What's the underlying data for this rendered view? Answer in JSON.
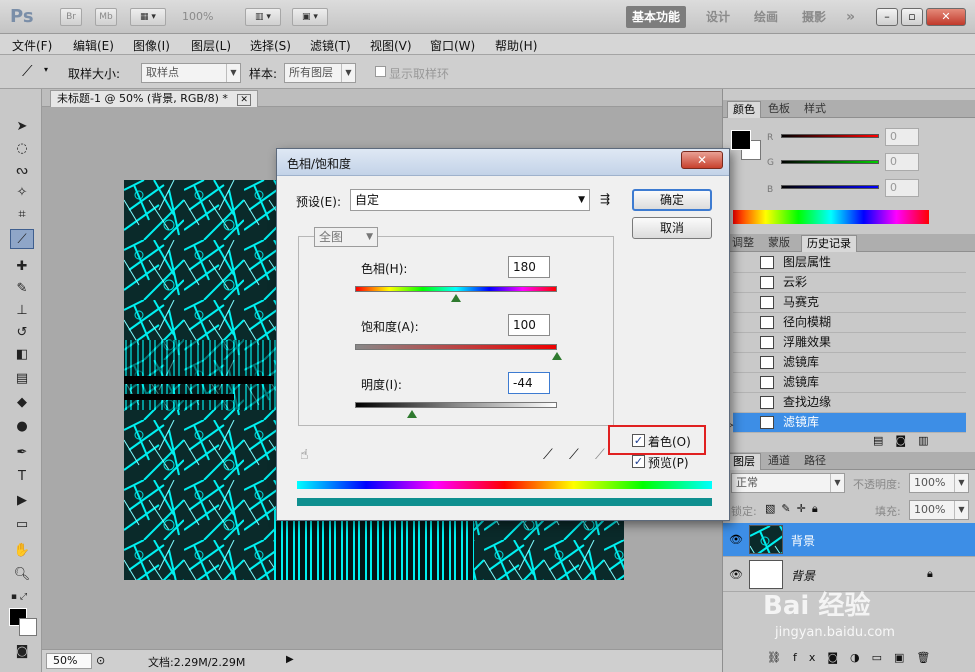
{
  "app": {
    "logo": "Ps",
    "zoom_readout": "100%"
  },
  "appbar": {
    "bridge": "Br",
    "minibridge": "Mb",
    "workspaces": [
      "基本功能",
      "设计",
      "绘画",
      "摄影"
    ],
    "more": "»",
    "window_buttons": [
      "–",
      "▫",
      "✕"
    ]
  },
  "menu": [
    "文件(F)",
    "编辑(E)",
    "图像(I)",
    "图层(L)",
    "选择(S)",
    "滤镜(T)",
    "视图(V)",
    "窗口(W)",
    "帮助(H)"
  ],
  "options": {
    "sample_size_label": "取样大小:",
    "sample_size_value": "取样点",
    "sample_label": "样本:",
    "sample_value": "所有图层",
    "show_ring_label": "显示取样环"
  },
  "document": {
    "tab_title": "未标题-1 @ 50% (背景, RGB/8) *",
    "status_zoom": "50%",
    "status_doc": "文档:2.29M/2.29M"
  },
  "color_panel": {
    "tabs": [
      "颜色",
      "色板",
      "样式"
    ],
    "channels": [
      {
        "label": "R",
        "value": "0"
      },
      {
        "label": "G",
        "value": "0"
      },
      {
        "label": "B",
        "value": "0"
      }
    ]
  },
  "history_panel": {
    "tabs": [
      "调整",
      "蒙版",
      "历史记录"
    ],
    "items": [
      "图层属性",
      "云彩",
      "马赛克",
      "径向模糊",
      "浮雕效果",
      "滤镜库",
      "滤镜库",
      "查找边缘",
      "滤镜库"
    ],
    "selected_index": 8
  },
  "layers_panel": {
    "tabs": [
      "图层",
      "通道",
      "路径"
    ],
    "blend_mode": "正常",
    "opacity_label": "不透明度:",
    "opacity_value": "100%",
    "lock_label": "锁定:",
    "fill_label": "填充:",
    "fill_value": "100%",
    "layers": [
      {
        "name": "背景",
        "selected": true
      },
      {
        "name": "背景",
        "selected": false,
        "italic": true
      }
    ]
  },
  "dialog": {
    "title": "色相/饱和度",
    "close": "✕",
    "preset_label": "预设(E):",
    "preset_value": "自定",
    "ok": "确定",
    "cancel": "取消",
    "channel_value": "全图",
    "hue_label": "色相(H):",
    "hue_value": "180",
    "hue_level": 0.5,
    "saturation_label": "饱和度(A):",
    "saturation_value": "100",
    "saturation_level": 1.0,
    "lightness_label": "明度(I):",
    "lightness_value": "-44",
    "lightness_level": 0.28,
    "colorize_label": "着色(O)",
    "colorize_checked": true,
    "preview_label": "预览(P)",
    "preview_checked": true
  },
  "colors": {
    "accent_blue": "#3d8ee6",
    "artwork_cyan": "#00f0f0",
    "highlight_red": "#e02020"
  },
  "watermark": {
    "brand": "Bai 经验",
    "url": "jingyan.baidu.com"
  }
}
